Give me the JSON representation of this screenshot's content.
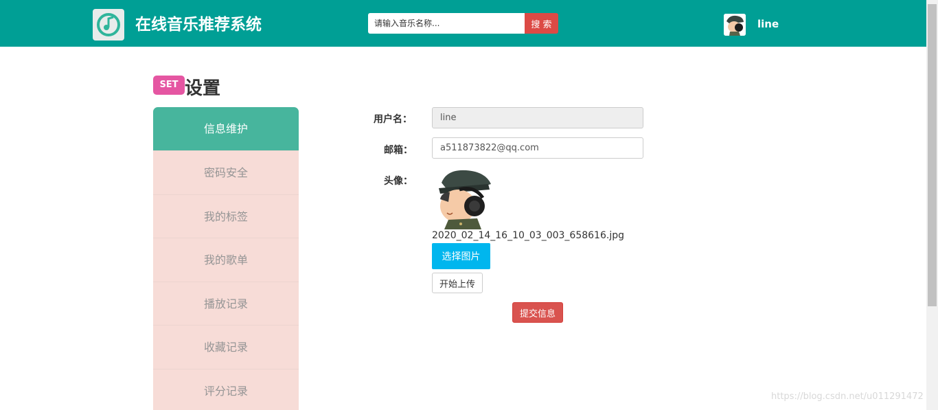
{
  "header": {
    "app_title": "在线音乐推荐系统",
    "search_placeholder": "请输入音乐名称...",
    "search_button": "搜 索",
    "username": "line",
    "bg_color": "#009f95"
  },
  "page": {
    "badge": "SET",
    "title": "设置"
  },
  "sidebar": {
    "items": [
      {
        "label": "信息维护",
        "active": true
      },
      {
        "label": "密码安全",
        "active": false
      },
      {
        "label": "我的标签",
        "active": false
      },
      {
        "label": "我的歌单",
        "active": false
      },
      {
        "label": "播放记录",
        "active": false
      },
      {
        "label": "收藏记录",
        "active": false
      },
      {
        "label": "评分记录",
        "active": false
      }
    ],
    "active_color": "#47b59d",
    "bg_color": "#f7dcd7"
  },
  "form": {
    "username_label": "用户名：",
    "username_value": "line",
    "email_label": "邮箱：",
    "email_value": "a511873822@qq.com",
    "avatar_label": "头像：",
    "avatar_filename": "2020_02_14_16_10_03_003_658616.jpg",
    "choose_button": "选择图片",
    "upload_button": "开始上传",
    "submit_button": "提交信息"
  },
  "watermark": "https://blog.csdn.net/u011291472"
}
